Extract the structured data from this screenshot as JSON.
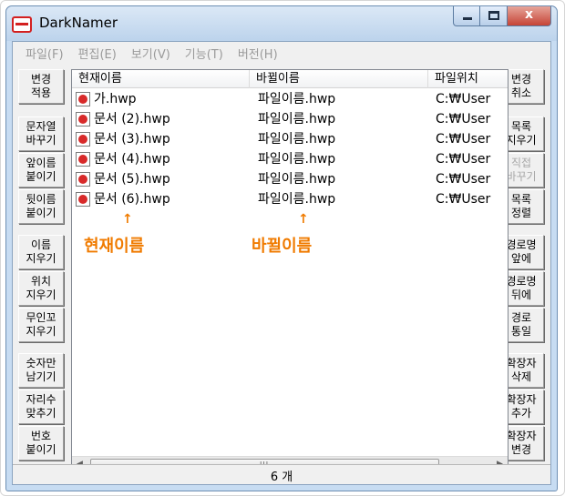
{
  "window": {
    "title": "DarkNamer",
    "close_glyph": "x"
  },
  "menu": [
    "파일(F)",
    "편집(E)",
    "보기(V)",
    "기능(T)",
    "버전(H)"
  ],
  "left_buttons": [
    {
      "label": "변경\n적용",
      "enabled": true
    },
    {
      "label": "문자열\n바꾸기",
      "enabled": true
    },
    {
      "label": "앞이름\n붙이기",
      "enabled": true
    },
    {
      "label": "뒷이름\n붙이기",
      "enabled": true
    },
    {
      "label": "이름\n지우기",
      "enabled": true
    },
    {
      "label": "위치\n지우기",
      "enabled": true
    },
    {
      "label": "무인꼬\n지우기",
      "enabled": true
    },
    {
      "label": "숫자만\n남기기",
      "enabled": true
    },
    {
      "label": "자리수\n맞추기",
      "enabled": true
    },
    {
      "label": "번호\n붙이기",
      "enabled": true
    }
  ],
  "right_buttons": [
    {
      "label": "변경\n취소",
      "enabled": true
    },
    {
      "label": "목록\n지우기",
      "enabled": true
    },
    {
      "label": "직접\n바꾸기",
      "enabled": false
    },
    {
      "label": "목록\n정렬",
      "enabled": true
    },
    {
      "label": "경로명\n앞에",
      "enabled": true
    },
    {
      "label": "경로명\n뒤에",
      "enabled": true
    },
    {
      "label": "경로\n통일",
      "enabled": true
    },
    {
      "label": "확장자\n삭제",
      "enabled": true
    },
    {
      "label": "확장자\n추가",
      "enabled": true
    },
    {
      "label": "확장자\n변경",
      "enabled": true
    }
  ],
  "list": {
    "columns": [
      "현재이름",
      "바뀔이름",
      "파일위치"
    ],
    "rows": [
      {
        "current": "가.hwp",
        "new": "파일이름.hwp",
        "location": "C:₩User"
      },
      {
        "current": "문서 (2).hwp",
        "new": "파일이름.hwp",
        "location": "C:₩User"
      },
      {
        "current": "문서 (3).hwp",
        "new": "파일이름.hwp",
        "location": "C:₩User"
      },
      {
        "current": "문서 (4).hwp",
        "new": "파일이름.hwp",
        "location": "C:₩User"
      },
      {
        "current": "문서 (5).hwp",
        "new": "파일이름.hwp",
        "location": "C:₩User"
      },
      {
        "current": "문서 (6).hwp",
        "new": "파일이름.hwp",
        "location": "C:₩User"
      }
    ]
  },
  "scrollbar": {
    "left": "◀",
    "right": "▶",
    "grip": "III"
  },
  "annotations": {
    "arrow": "↑",
    "current_label": "현재이름",
    "new_label": "바뀔이름"
  },
  "status": {
    "count_text": "6 개"
  },
  "colors": {
    "annotation": "#f07b00",
    "app_icon": "#d32020",
    "close_button": "#c64436"
  }
}
